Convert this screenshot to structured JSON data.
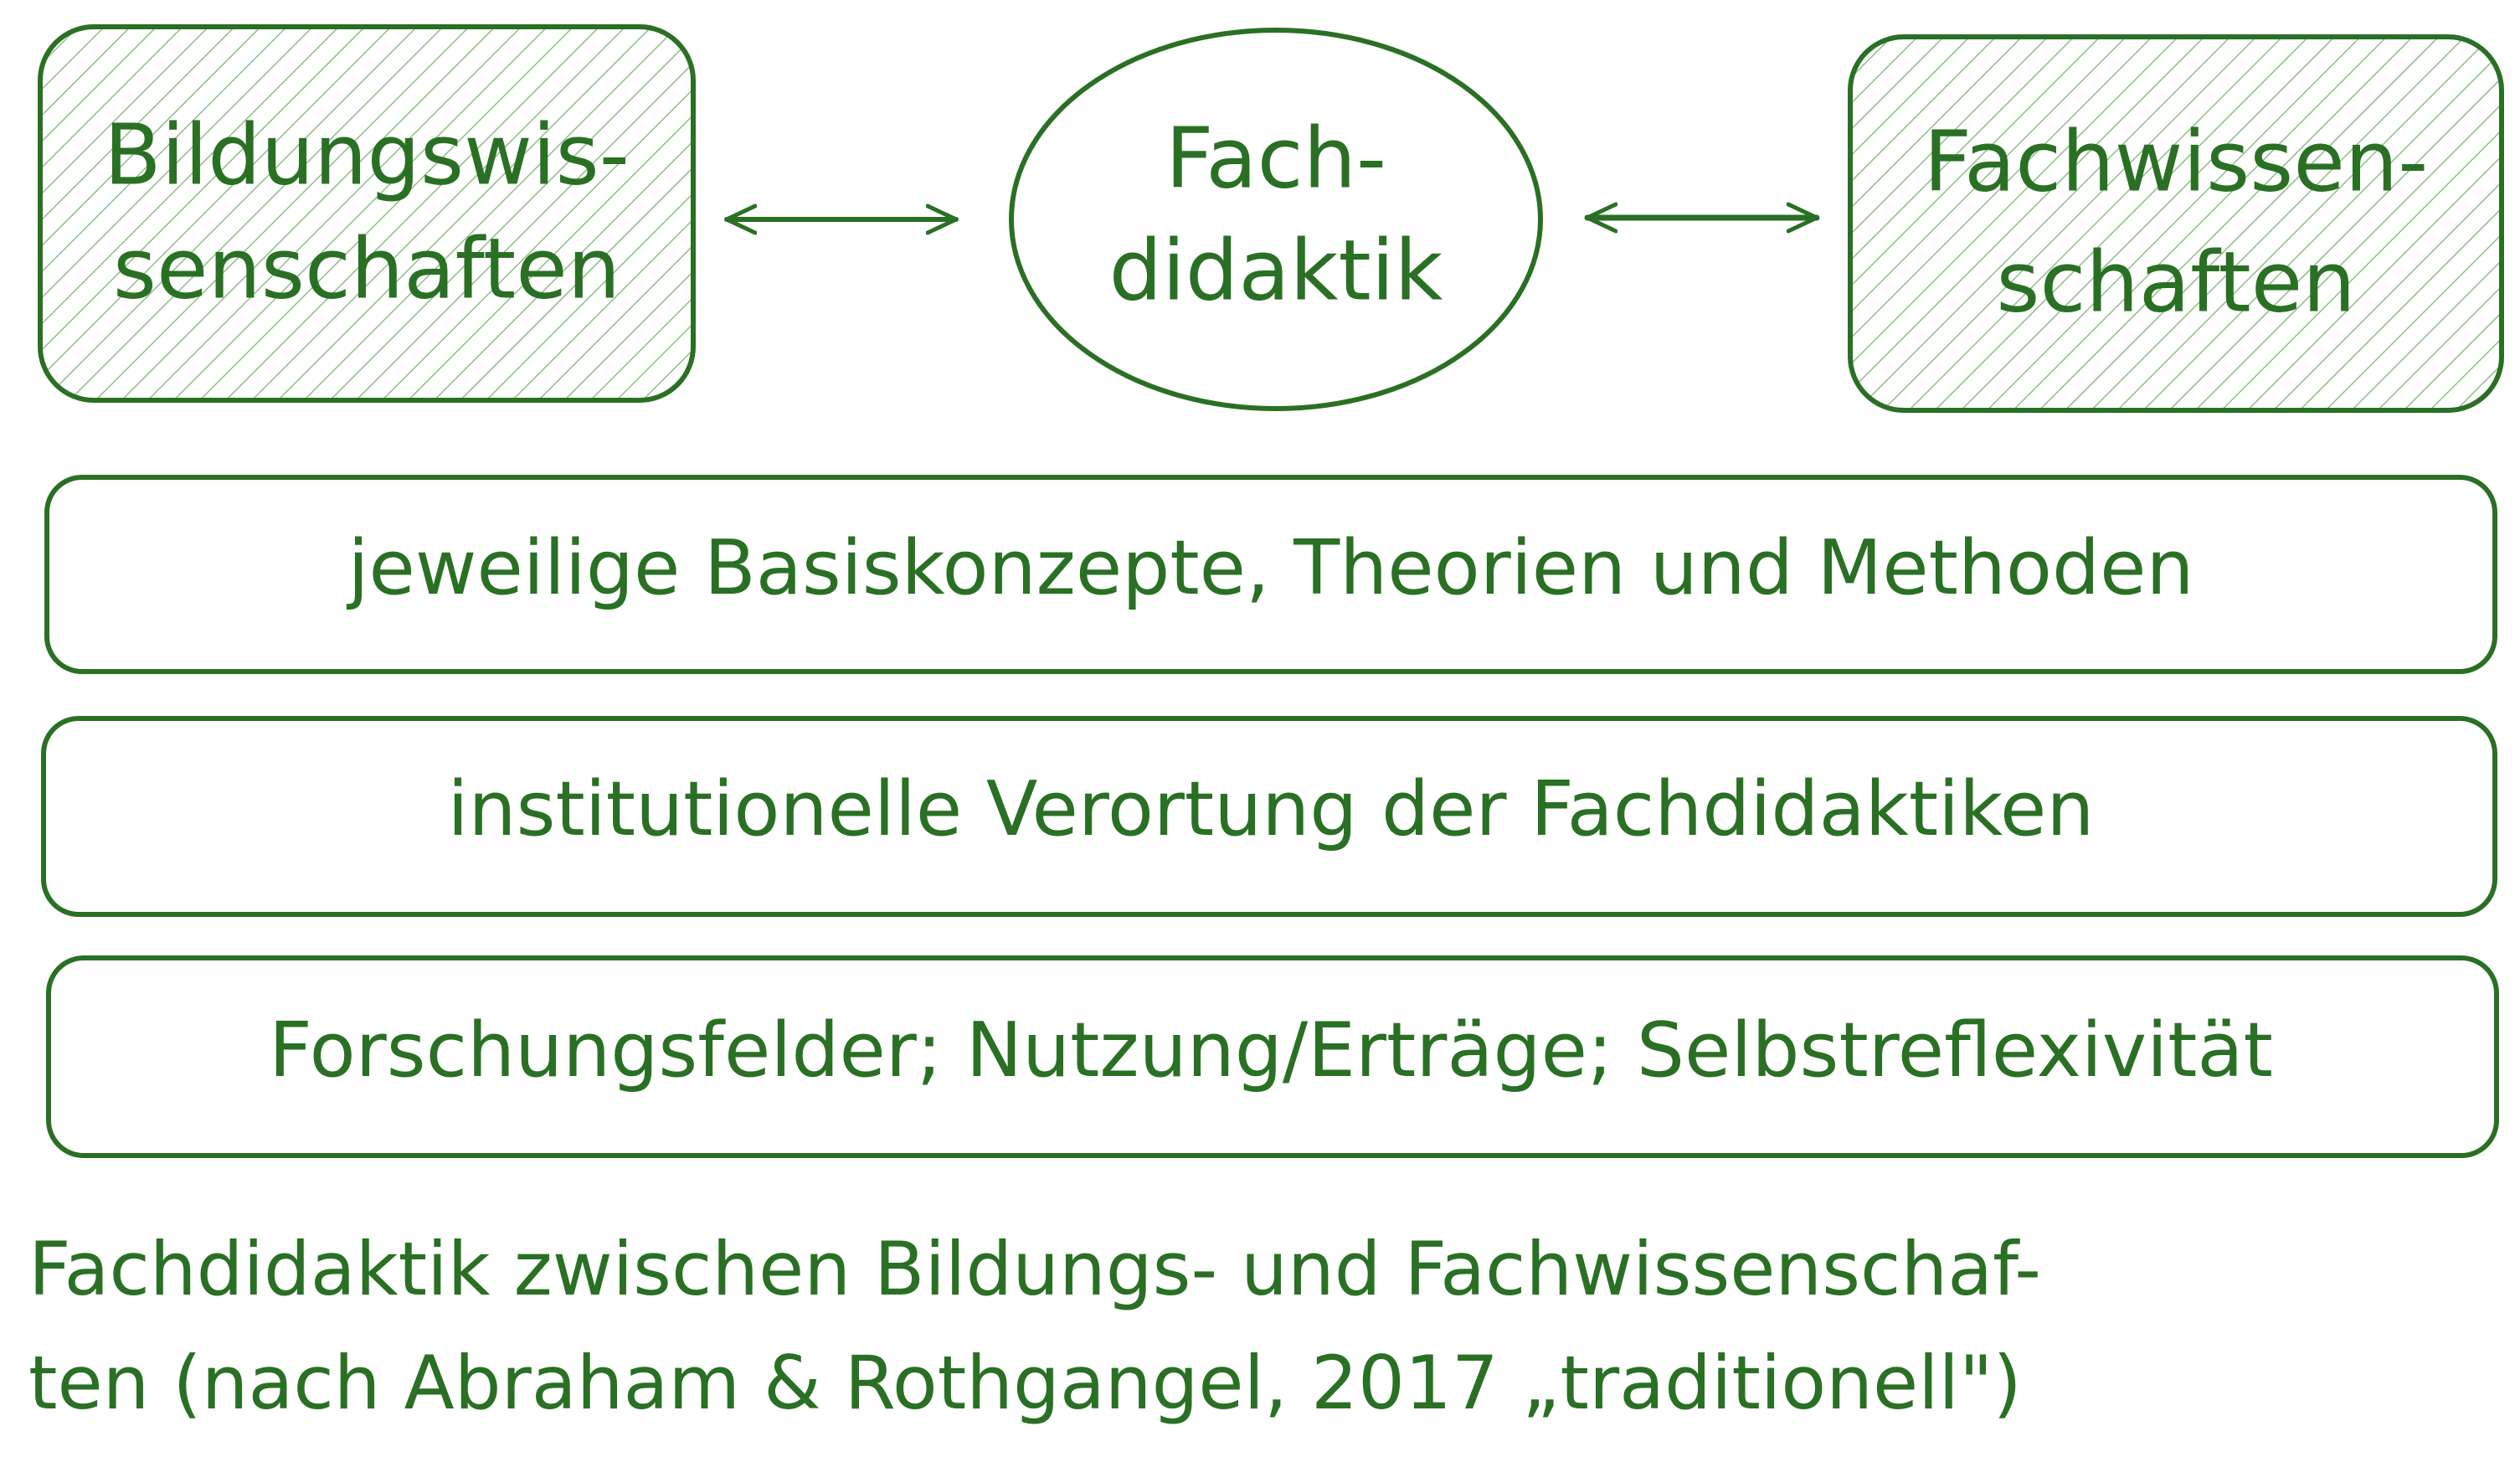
{
  "colors": {
    "stroke": "#2a7024",
    "text": "#2a7024",
    "hatch": "#8fbd88",
    "background": "#ffffff"
  },
  "nodes": {
    "left": {
      "line1": "Bildungswis-",
      "line2": "senschaften"
    },
    "center": {
      "line1": "Fach-",
      "line2": "didaktik"
    },
    "right": {
      "line1": "Fachwissen-",
      "line2": "schaften"
    }
  },
  "arrows": [
    {
      "from": "left",
      "to": "center",
      "type": "bidirectional"
    },
    {
      "from": "center",
      "to": "right",
      "type": "bidirectional"
    }
  ],
  "layers": [
    "jeweilige Basiskonzepte, Theorien und Methoden",
    "institutionelle Verortung der Fachdidaktiken",
    "Forschungsfelder; Nutzung/Erträge; Selbstreflexivität"
  ],
  "caption": {
    "line1": "Fachdidaktik zwischen Bildungs- und Fachwissenschaf-",
    "line2": "ten (nach Abraham & Rothgangel, 2017 „traditionell\")"
  }
}
